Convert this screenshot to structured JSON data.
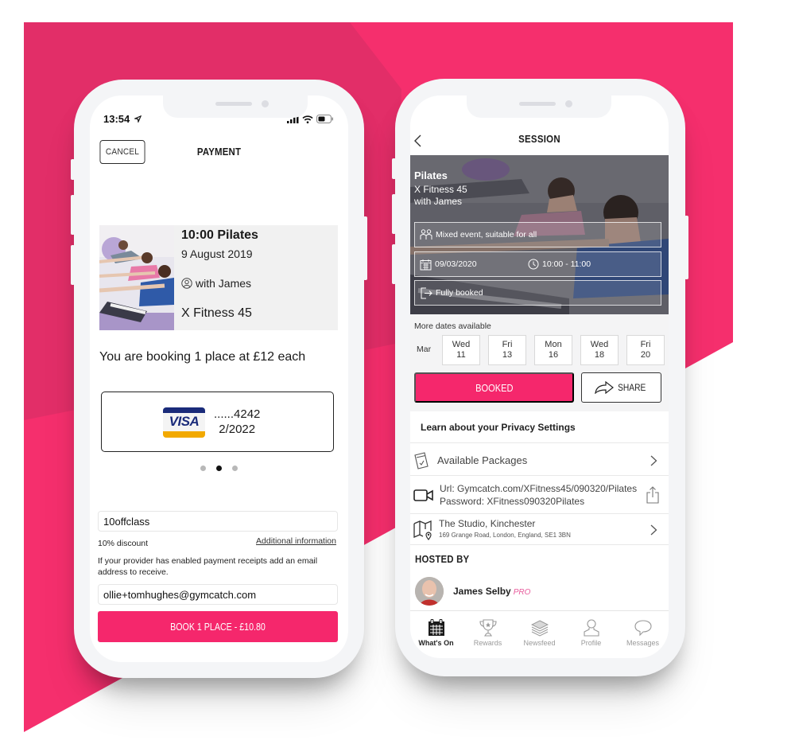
{
  "colors": {
    "brand_pink": "#F52F6D",
    "brand_pink_dark": "#E22E68",
    "button_pink": "#F5276C",
    "pro_badge": "#E75A9B",
    "visa_blue": "#1A2B7A",
    "visa_gold": "#F2A900"
  },
  "payment_screen": {
    "status_bar": {
      "time": "13:54",
      "icons": [
        "location-arrow-icon",
        "signal-icon",
        "wifi-icon",
        "battery-icon"
      ]
    },
    "header": {
      "cancel_label": "CANCEL",
      "title": "PAYMENT"
    },
    "class_card": {
      "title": "10:00 Pilates",
      "date": "9 August 2019",
      "instructor": "with James",
      "gym": "X Fitness 45"
    },
    "booking_summary": "You are booking 1 place at £12 each",
    "saved_card": {
      "brand": "VISA",
      "number_masked": "......4242",
      "expiry": "2/2022"
    },
    "carousel": {
      "count": 3,
      "active_index": 1
    },
    "promo_code": {
      "value": "10offclass"
    },
    "discount_text": "10% discount",
    "additional_info_link": "Additional information",
    "receipt_note": "If your provider has enabled payment receipts add an email address to receive.",
    "email": {
      "value": "ollie+tomhughes@gymcatch.com"
    },
    "book_button_label": "BOOK 1 PLACE - £10.80"
  },
  "session_screen": {
    "header": {
      "title": "SESSION"
    },
    "hero": {
      "title": "Pilates",
      "gym": "X Fitness 45",
      "instructor": "with James",
      "suitability": "Mixed event, suitable for all",
      "date": "09/03/2020",
      "time": "10:00 - 11:00",
      "availability": "Fully booked"
    },
    "more_dates": {
      "label": "More dates available",
      "month": "Mar",
      "dates": [
        {
          "day": "Wed",
          "num": "11"
        },
        {
          "day": "Fri",
          "num": "13"
        },
        {
          "day": "Mon",
          "num": "16"
        },
        {
          "day": "Wed",
          "num": "18"
        },
        {
          "day": "Fri",
          "num": "20"
        }
      ]
    },
    "booked_label": "BOOKED",
    "share_label": "SHARE",
    "privacy_link": "Learn about your Privacy Settings",
    "packages_label": "Available Packages",
    "online": {
      "url_label": "Url",
      "url_value": ": Gymcatch.com/XFitness45/090320/Pilates",
      "password_line": "Password: XFitness090320Pilates"
    },
    "location": {
      "name": "The Studio, Kinchester",
      "address": "169 Grange Road, London, England, SE1 3BN"
    },
    "hosted_by_label": "HOSTED BY",
    "host": {
      "name": "James Selby",
      "badge": "PRO"
    },
    "tabs": [
      {
        "label": "What's On",
        "icon": "calendar-icon",
        "active": true
      },
      {
        "label": "Rewards",
        "icon": "trophy-icon",
        "active": false
      },
      {
        "label": "Newsfeed",
        "icon": "stack-icon",
        "active": false
      },
      {
        "label": "Profile",
        "icon": "person-icon",
        "active": false
      },
      {
        "label": "Messages",
        "icon": "speech-bubble-icon",
        "active": false
      }
    ]
  }
}
